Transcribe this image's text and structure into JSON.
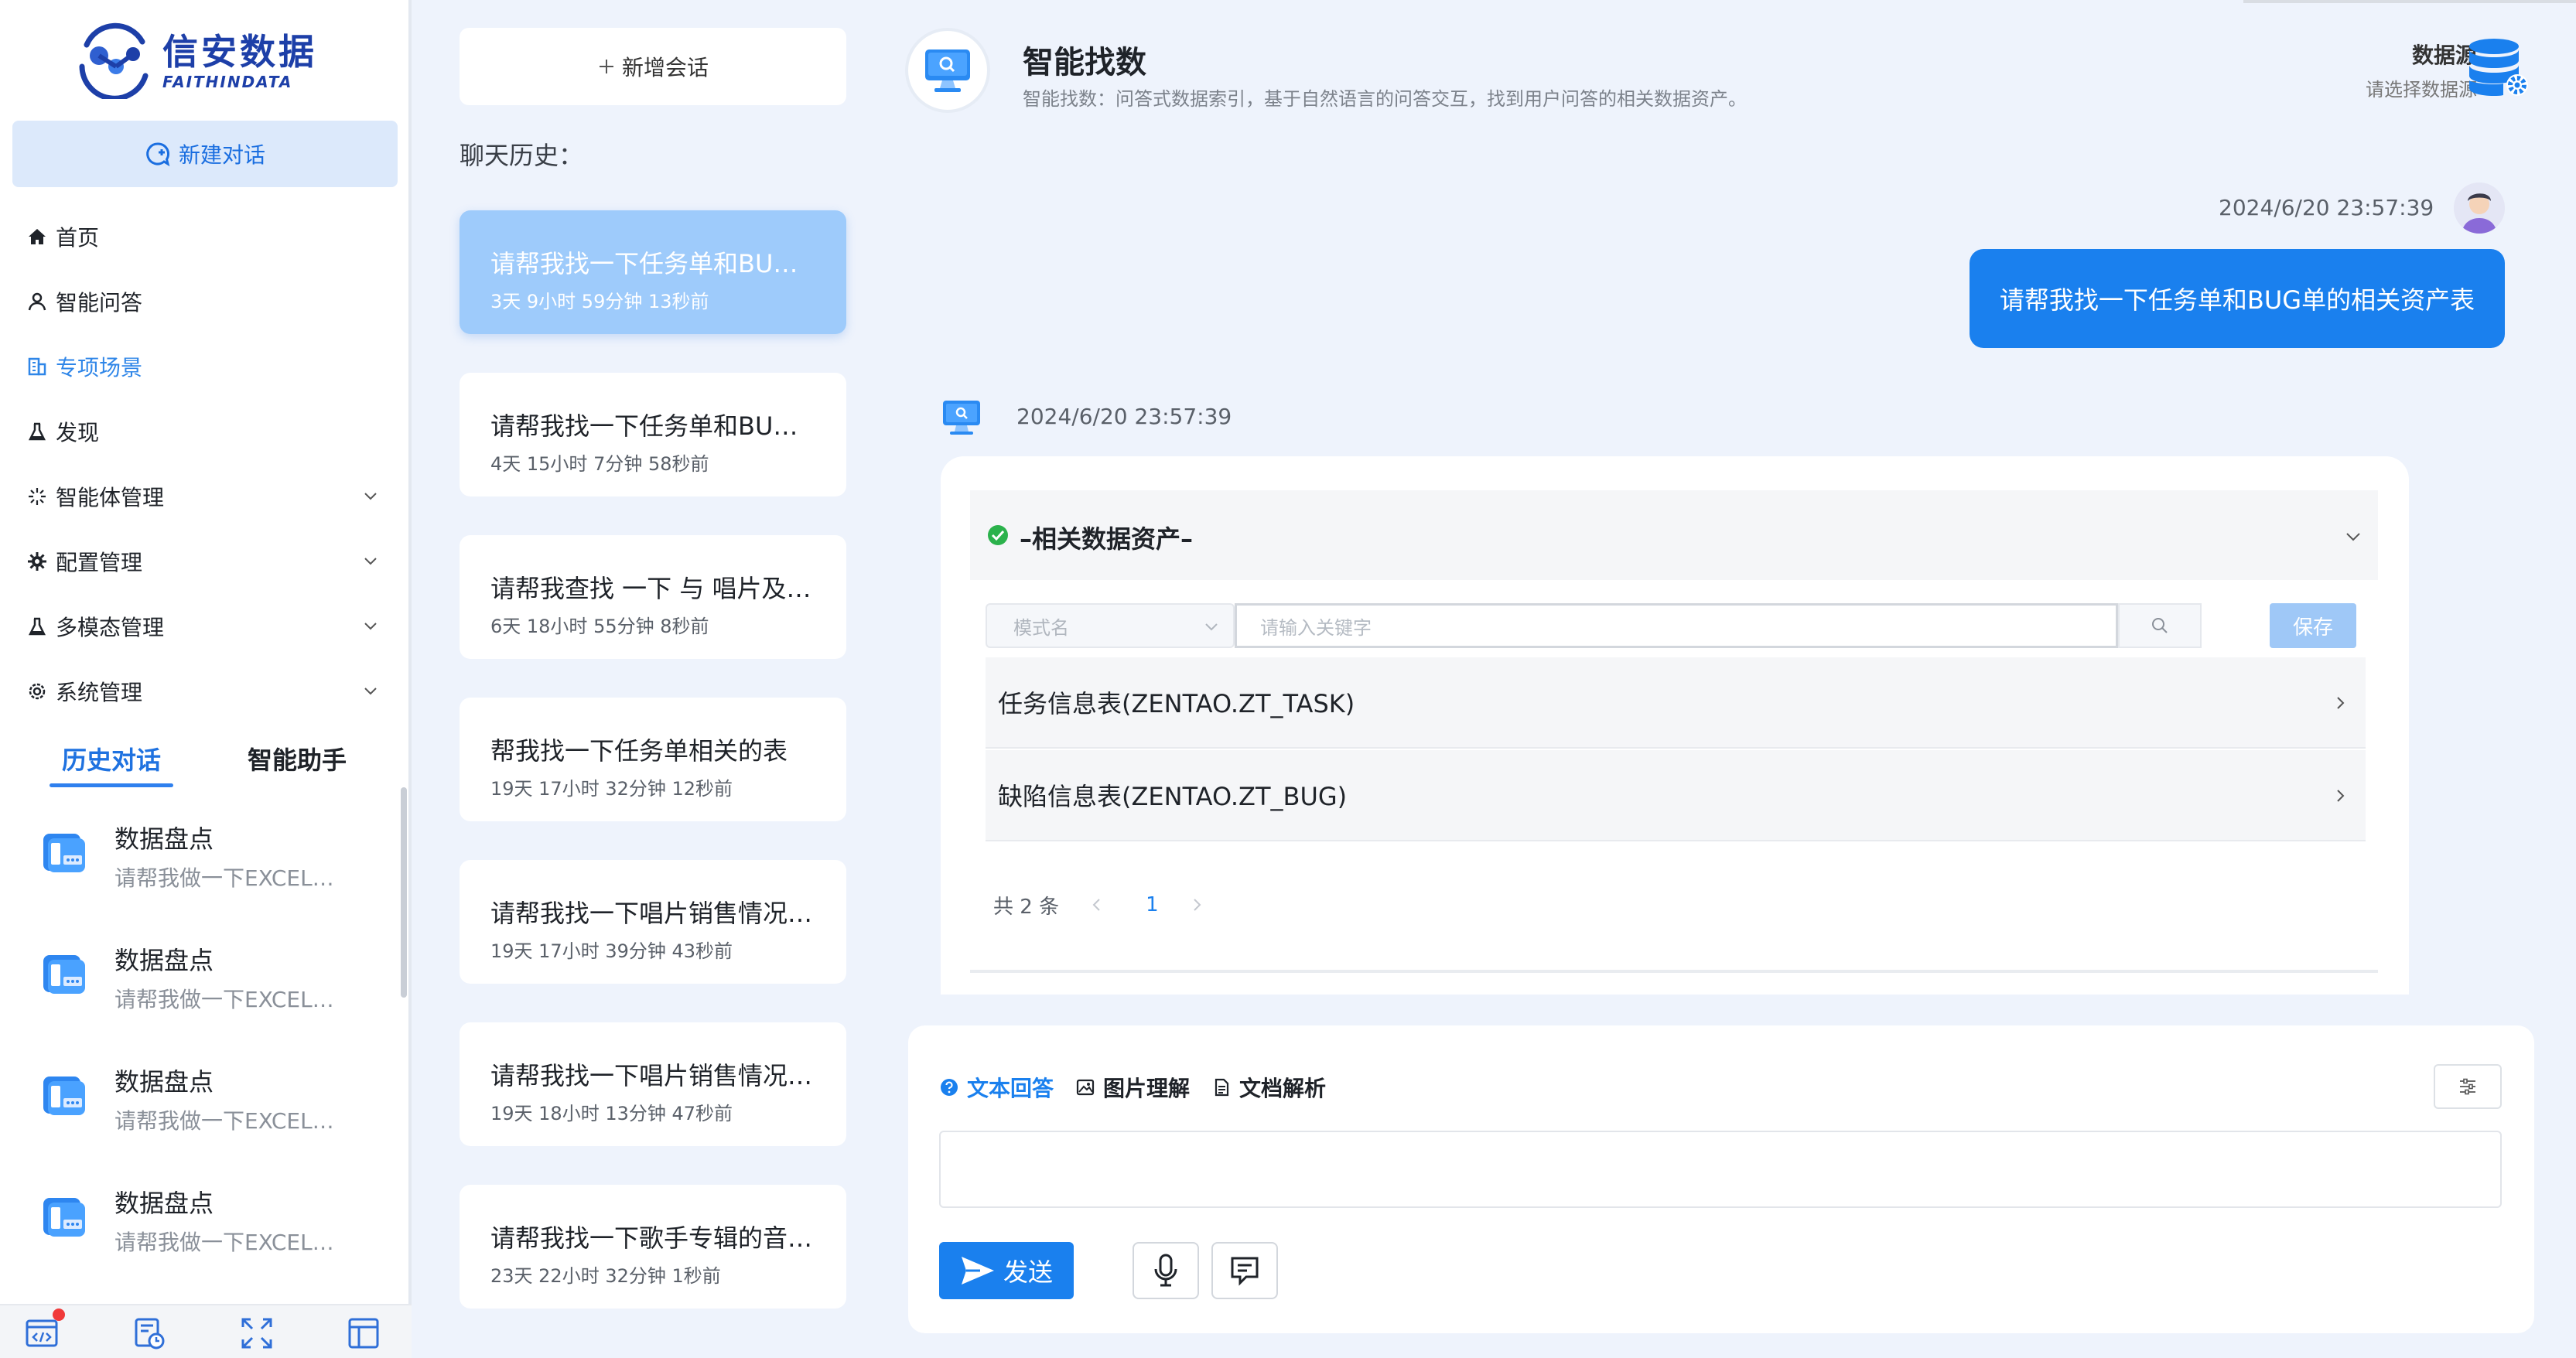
{
  "brand": {
    "name_cn": "信安数据",
    "name_en": "FAITHINDATA"
  },
  "sidebar": {
    "new_chat_label": "新建对话",
    "nav": [
      {
        "label": "首页",
        "icon": "home-icon",
        "expandable": false
      },
      {
        "label": "智能问答",
        "icon": "user-icon",
        "expandable": false
      },
      {
        "label": "专项场景",
        "icon": "building-icon",
        "expandable": false,
        "active": true
      },
      {
        "label": "发现",
        "icon": "flask-icon",
        "expandable": false
      },
      {
        "label": "智能体管理",
        "icon": "sparkle-icon",
        "expandable": true
      },
      {
        "label": "配置管理",
        "icon": "gear-icon",
        "expandable": true
      },
      {
        "label": "多模态管理",
        "icon": "flask-icon",
        "expandable": true
      },
      {
        "label": "系统管理",
        "icon": "settings-icon",
        "expandable": true
      }
    ],
    "tabs": {
      "history": "历史对话",
      "assistant": "智能助手"
    },
    "conversations": [
      {
        "title": "数据盘点",
        "snippet": "请帮我做一下EXCEL…"
      },
      {
        "title": "数据盘点",
        "snippet": "请帮我做一下EXCEL…"
      },
      {
        "title": "数据盘点",
        "snippet": "请帮我做一下EXCEL…"
      },
      {
        "title": "数据盘点",
        "snippet": "请帮我做一下EXCEL…"
      }
    ],
    "bottom_icons": [
      "code-window-icon",
      "report-clock-icon",
      "expand-icon",
      "layout-icon"
    ]
  },
  "history": {
    "new_session_label": "新增会话",
    "title": "聊天历史：",
    "items": [
      {
        "title": "请帮我找一下任务单和BUG单的相关资产表",
        "time": "3天 9小时 59分钟 13秒前",
        "active": true
      },
      {
        "title": "请帮我找一下任务单和BUG单的相关资产表",
        "time": "4天 15小时 7分钟 58秒前"
      },
      {
        "title": "请帮我查找 一下 与 唱片及销售相关的表",
        "time": "6天 18小时 55分钟 8秒前"
      },
      {
        "title": "帮我找一下任务单相关的表",
        "time": "19天 17小时 32分钟 12秒前"
      },
      {
        "title": "请帮我找一下唱片销售情况相关的表",
        "time": "19天 17小时 39分钟 43秒前"
      },
      {
        "title": "请帮我找一下唱片销售情况相关的表",
        "time": "19天 18小时 13分钟 47秒前"
      },
      {
        "title": "请帮我找一下歌手专辑的音乐相关的表",
        "time": "23天 22小时 32分钟 1秒前"
      }
    ]
  },
  "main": {
    "title": "智能找数",
    "description": "智能找数：问答式数据索引，基于自然语言的问答交互，找到用户问答的相关数据资产。",
    "datasource": {
      "label": "数据源",
      "placeholder": "请选择数据源"
    },
    "user_message": {
      "time": "2024/6/20 23:57:39",
      "text": "请帮我找一下任务单和BUG单的相关资产表"
    },
    "bot_message": {
      "time": "2024/6/20 23:57:39",
      "section_title": "–相关数据资产–",
      "model_placeholder": "模式名",
      "keyword_placeholder": "请输入关键字",
      "save_label": "保存",
      "rows": [
        "任务信息表(ZENTAO.ZT_TASK)",
        "缺陷信息表(ZENTAO.ZT_BUG)"
      ],
      "total_label": "共 2 条",
      "current_page": "1"
    }
  },
  "composer": {
    "modes": [
      {
        "label": "文本回答",
        "icon": "question-circle-icon",
        "active": true
      },
      {
        "label": "图片理解",
        "icon": "image-icon"
      },
      {
        "label": "文档解析",
        "icon": "document-icon"
      }
    ],
    "input_value": "",
    "send_label": "发送"
  },
  "colors": {
    "primary": "#1a80ee",
    "active_card": "#9ecbfb",
    "background": "#eef3fc",
    "success": "#2bb24c",
    "danger": "#f03a3a"
  }
}
